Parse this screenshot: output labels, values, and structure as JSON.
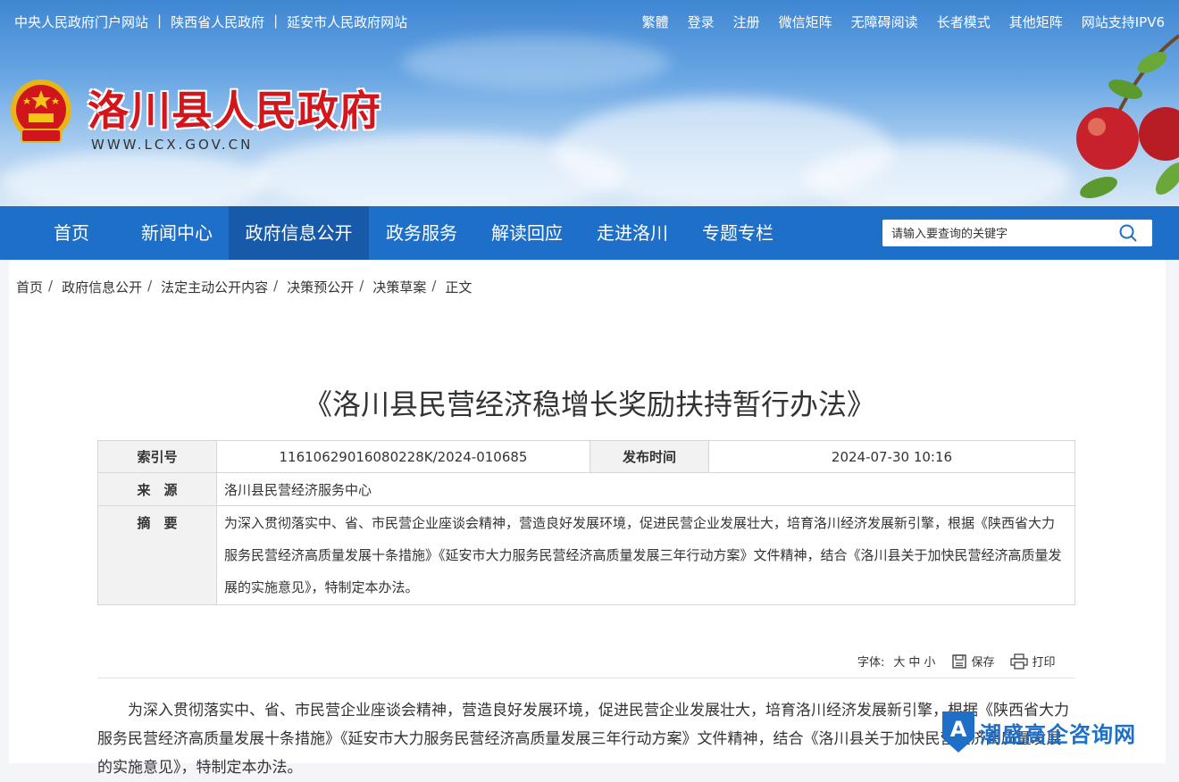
{
  "topbar": {
    "left_links": [
      "中央人民政府门户网站",
      "陕西省人民政府",
      "延安市人民政府网站"
    ],
    "separator": "|",
    "right_links": [
      "繁體",
      "登录",
      "注册",
      "微信矩阵",
      "无障碍阅读",
      "长者模式",
      "其他矩阵",
      "网站支持IPV6"
    ]
  },
  "header": {
    "site_title": "洛川县人民政府",
    "site_url": "WWW.LCX.GOV.CN"
  },
  "nav": {
    "items": [
      "首页",
      "新闻中心",
      "政府信息公开",
      "政务服务",
      "解读回应",
      "走进洛川",
      "专题专栏"
    ],
    "active_index": 2,
    "search_placeholder": "请输入要查询的关键字"
  },
  "breadcrumb": [
    "首页",
    "政府信息公开",
    "法定主动公开内容",
    "决策预公开",
    "决策草案",
    "正文"
  ],
  "breadcrumb_sep": "/",
  "document": {
    "title": "《洛川县民营经济稳增长奖励扶持暂行办法》",
    "index_label": "索引号",
    "index_value": "11610629016080228K/2024-010685",
    "date_label": "发布时间",
    "date_value": "2024-07-30 10:16",
    "source_label": "来　源",
    "source_value": "洛川县民营经济服务中心",
    "summary_label": "摘　要",
    "summary_value": "为深入贯彻落实中、省、市民营企业座谈会精神，营造良好发展环境，促进民营企业发展壮大，培育洛川经济发展新引擎，根据《陕西省大力服务民营经济高质量发展十条措施》《延安市大力服务民营经济高质量发展三年行动方案》文件精神，结合《洛川县关于加快民营经济高质量发展的实施意见》，特制定本办法。"
  },
  "tools": {
    "font_label": "字体:",
    "font_large": "大",
    "font_medium": "中",
    "font_small": "小",
    "save_label": "保存",
    "print_label": "打印"
  },
  "body_text": "为深入贯彻落实中、省、市民营企业座谈会精神，营造良好发展环境，促进民营企业发展壮大，培育洛川经济发展新引擎，根据《陕西省大力服务民营经济高质量发展十条措施》《延安市大力服务民营经济高质量发展三年行动方案》文件精神，结合《洛川县关于加快民营经济高质量发展的实施意见》，特制定本办法。",
  "watermark": {
    "text": "潮盛高企咨询网"
  },
  "colors": {
    "nav_blue": "#1e6fc8",
    "nav_active": "#165aa9",
    "title_red": "#d3161b"
  }
}
